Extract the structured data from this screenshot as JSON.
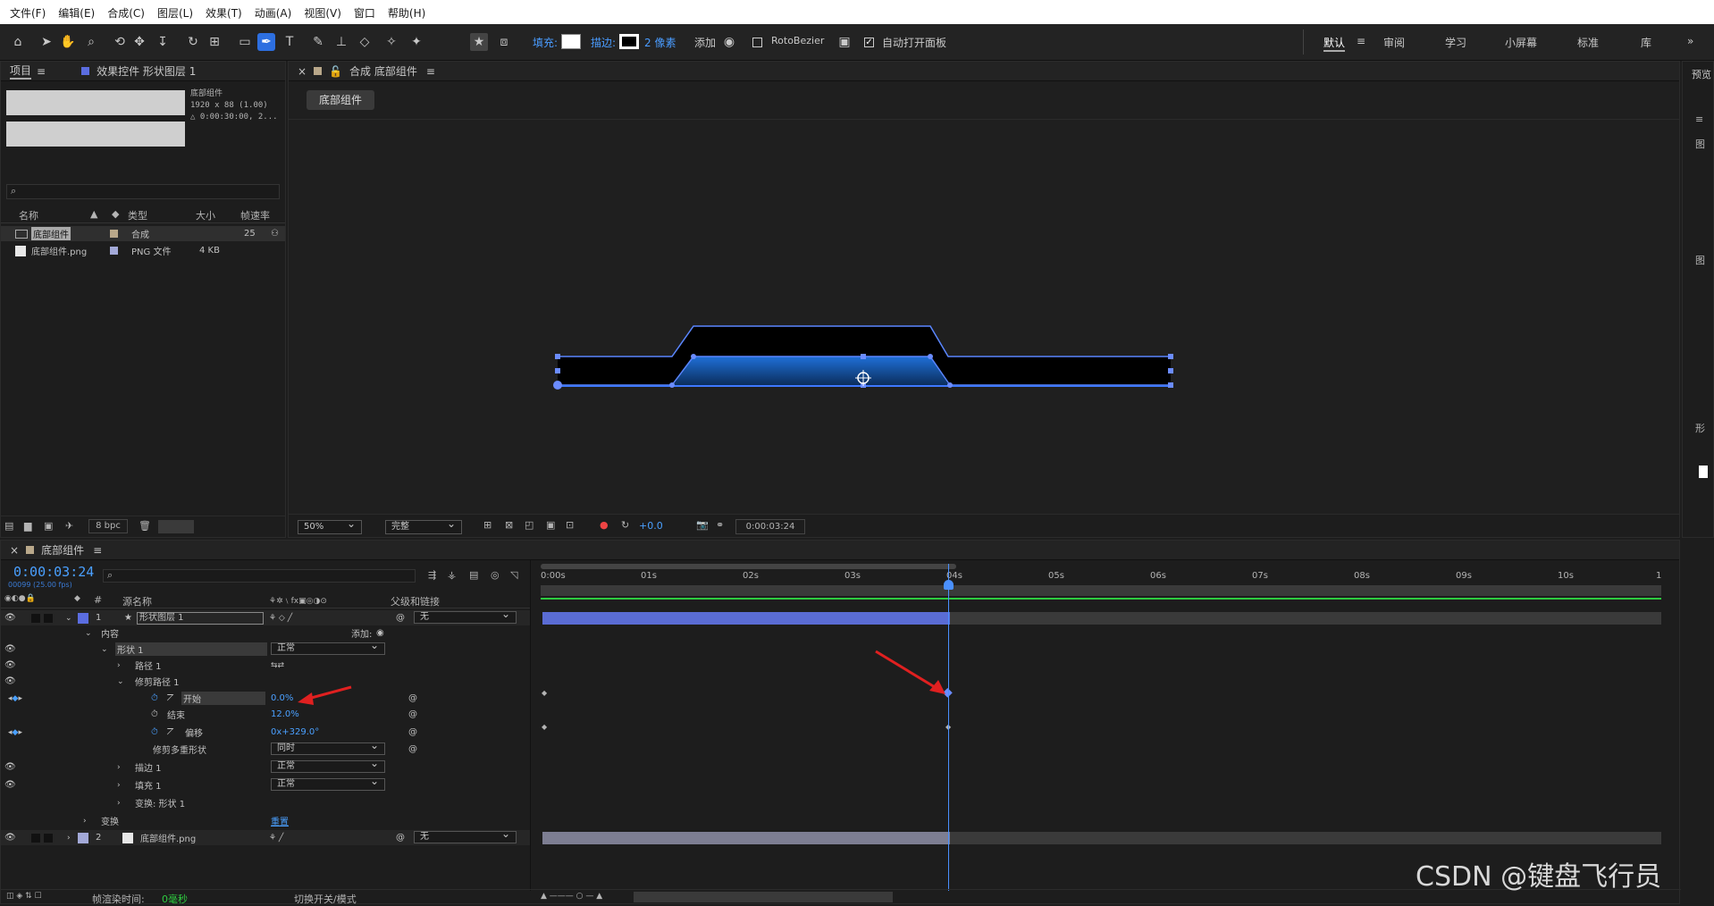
{
  "menu": [
    "文件(F)",
    "编辑(E)",
    "合成(C)",
    "图层(L)",
    "效果(T)",
    "动画(A)",
    "视图(V)",
    "窗口",
    "帮助(H)"
  ],
  "toolbar": {
    "fill_label": "填充:",
    "stroke_label": "描边:",
    "stroke_width": "2 像素",
    "add_label": "添加",
    "rotobezier": "RotoBezier",
    "auto_open": "自动打开面板"
  },
  "workspaces": [
    "默认",
    "审阅",
    "学习",
    "小屏幕",
    "标准",
    "库"
  ],
  "project": {
    "tab": "项目",
    "effects_tab": "效果控件 形状图层 1",
    "comp_name": "底部组件",
    "comp_info1": "1920 x 88 (1.00)",
    "comp_info2": "△ 0:00:30:00, 2...",
    "columns": [
      "名称",
      "类型",
      "大小",
      "帧速率"
    ],
    "items": [
      {
        "name": "底部组件",
        "type": "合成",
        "size": "",
        "fps": "25"
      },
      {
        "name": "底部组件.png",
        "type": "PNG 文件",
        "size": "4 KB",
        "fps": ""
      }
    ],
    "bpc": "8 bpc"
  },
  "comp": {
    "tab": "合成 底部组件",
    "crumb": "底部组件",
    "zoom": "50%",
    "quality": "完整",
    "exposure": "+0.0",
    "time": "0:00:03:24"
  },
  "right_panel": {
    "title": "预览",
    "labels": [
      "图",
      "图",
      "形",
      "形"
    ]
  },
  "timeline": {
    "tab": "底部组件",
    "timecode": "0:00:03:24",
    "frame": "00099 (25.00 fps)",
    "col_source": "源名称",
    "col_parent": "父级和链接",
    "ticks": [
      "0:00s",
      "01s",
      "02s",
      "03s",
      "04s",
      "05s",
      "06s",
      "07s",
      "08s",
      "09s",
      "10s",
      "1"
    ],
    "rows": [
      {
        "name": "形状图层 1",
        "num": "1",
        "parent": "无"
      },
      {
        "name": "内容",
        "extra": "添加:"
      },
      {
        "name": "形状 1",
        "mode": "正常"
      },
      {
        "name": "路径 1"
      },
      {
        "name": "修剪路径 1"
      },
      {
        "name": "开始",
        "value": "0.0%"
      },
      {
        "name": "结束",
        "value": "12.0%"
      },
      {
        "name": "偏移",
        "value": "0x+329.0°"
      },
      {
        "name": "修剪多重形状",
        "mode": "同时"
      },
      {
        "name": "描边 1",
        "mode": "正常"
      },
      {
        "name": "填充 1",
        "mode": "正常"
      },
      {
        "name": "变换: 形状 1"
      },
      {
        "name": "变换",
        "value": "重置"
      },
      {
        "name": "底部组件.png",
        "num": "2",
        "parent": "无"
      }
    ],
    "footer_label": "帧渲染时间:",
    "footer_value": "0毫秒",
    "footer_toggle": "切换开关/模式"
  },
  "watermark": "CSDN @键盘飞行员"
}
